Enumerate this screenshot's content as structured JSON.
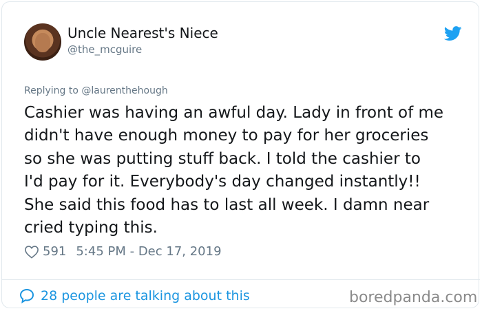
{
  "author": {
    "name": "Uncle Nearest's Niece",
    "handle": "@the_mcguire"
  },
  "reply": {
    "prefix": "Replying to",
    "user": "@laurenthehough"
  },
  "tweet": {
    "text": "Cashier was having an awful day. Lady in front of me\ndidn't have enough money to pay for her groceries\nso she was putting stuff back. I told the cashier to\nI'd pay for it. Everybody's day changed instantly!!\nShe said this food has to last all week. I damn near\ncried typing this."
  },
  "meta": {
    "likes": "591",
    "timestamp": "5:45 PM - Dec 17, 2019"
  },
  "footer": {
    "talking": "28 people are talking about this",
    "watermark": "boredpanda.com"
  },
  "colors": {
    "twitter_blue": "#1da1f2",
    "link_blue": "#1b95e0",
    "gray": "#657786"
  },
  "icons": [
    "twitter-bird-icon",
    "heart-icon",
    "speech-bubble-icon"
  ]
}
